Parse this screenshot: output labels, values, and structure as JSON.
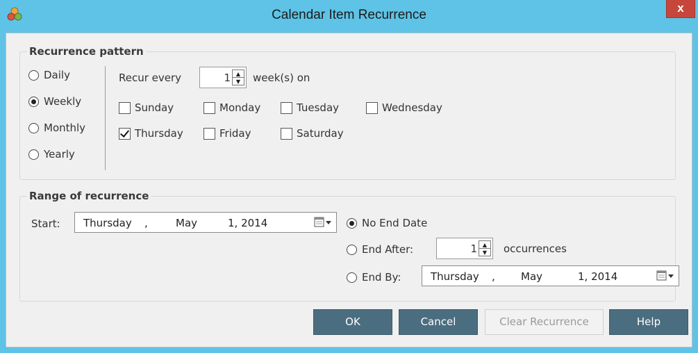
{
  "window": {
    "title": "Calendar Item Recurrence",
    "close_label": "x",
    "icon": "app-logo-icon"
  },
  "recurrence_pattern": {
    "legend": "Recurrence pattern",
    "frequency_options": [
      "Daily",
      "Weekly",
      "Monthly",
      "Yearly"
    ],
    "selected_frequency": "Weekly",
    "recur_every_label": "Recur every",
    "recur_every_value": "1",
    "weeks_on_label": "week(s) on",
    "days": [
      {
        "label": "Sunday",
        "checked": false
      },
      {
        "label": "Monday",
        "checked": false
      },
      {
        "label": "Tuesday",
        "checked": false
      },
      {
        "label": "Wednesday",
        "checked": false
      },
      {
        "label": "Thursday",
        "checked": true
      },
      {
        "label": "Friday",
        "checked": false
      },
      {
        "label": "Saturday",
        "checked": false
      }
    ]
  },
  "range_of_recurrence": {
    "legend": "Range of recurrence",
    "start_label": "Start:",
    "start_date": {
      "weekday": "Thursday",
      "sep": ",",
      "month": "May",
      "daynum_year": "1, 2014"
    },
    "end_options": {
      "no_end": "No End Date",
      "end_after": "End After:",
      "end_by": "End By:"
    },
    "selected_end_option": "No End Date",
    "occurrences_value": "1",
    "occurrences_label": "occurrences",
    "end_by_date": {
      "weekday": "Thursday",
      "sep": ",",
      "month": "May",
      "daynum_year": "1, 2014"
    }
  },
  "buttons": {
    "ok": "OK",
    "cancel": "Cancel",
    "clear": "Clear Recurrence",
    "help": "Help"
  },
  "colors": {
    "titlebar": "#5ec3e6",
    "close": "#c7463b",
    "button": "#4b6d80",
    "disabled_text": "#9a9a9a"
  }
}
